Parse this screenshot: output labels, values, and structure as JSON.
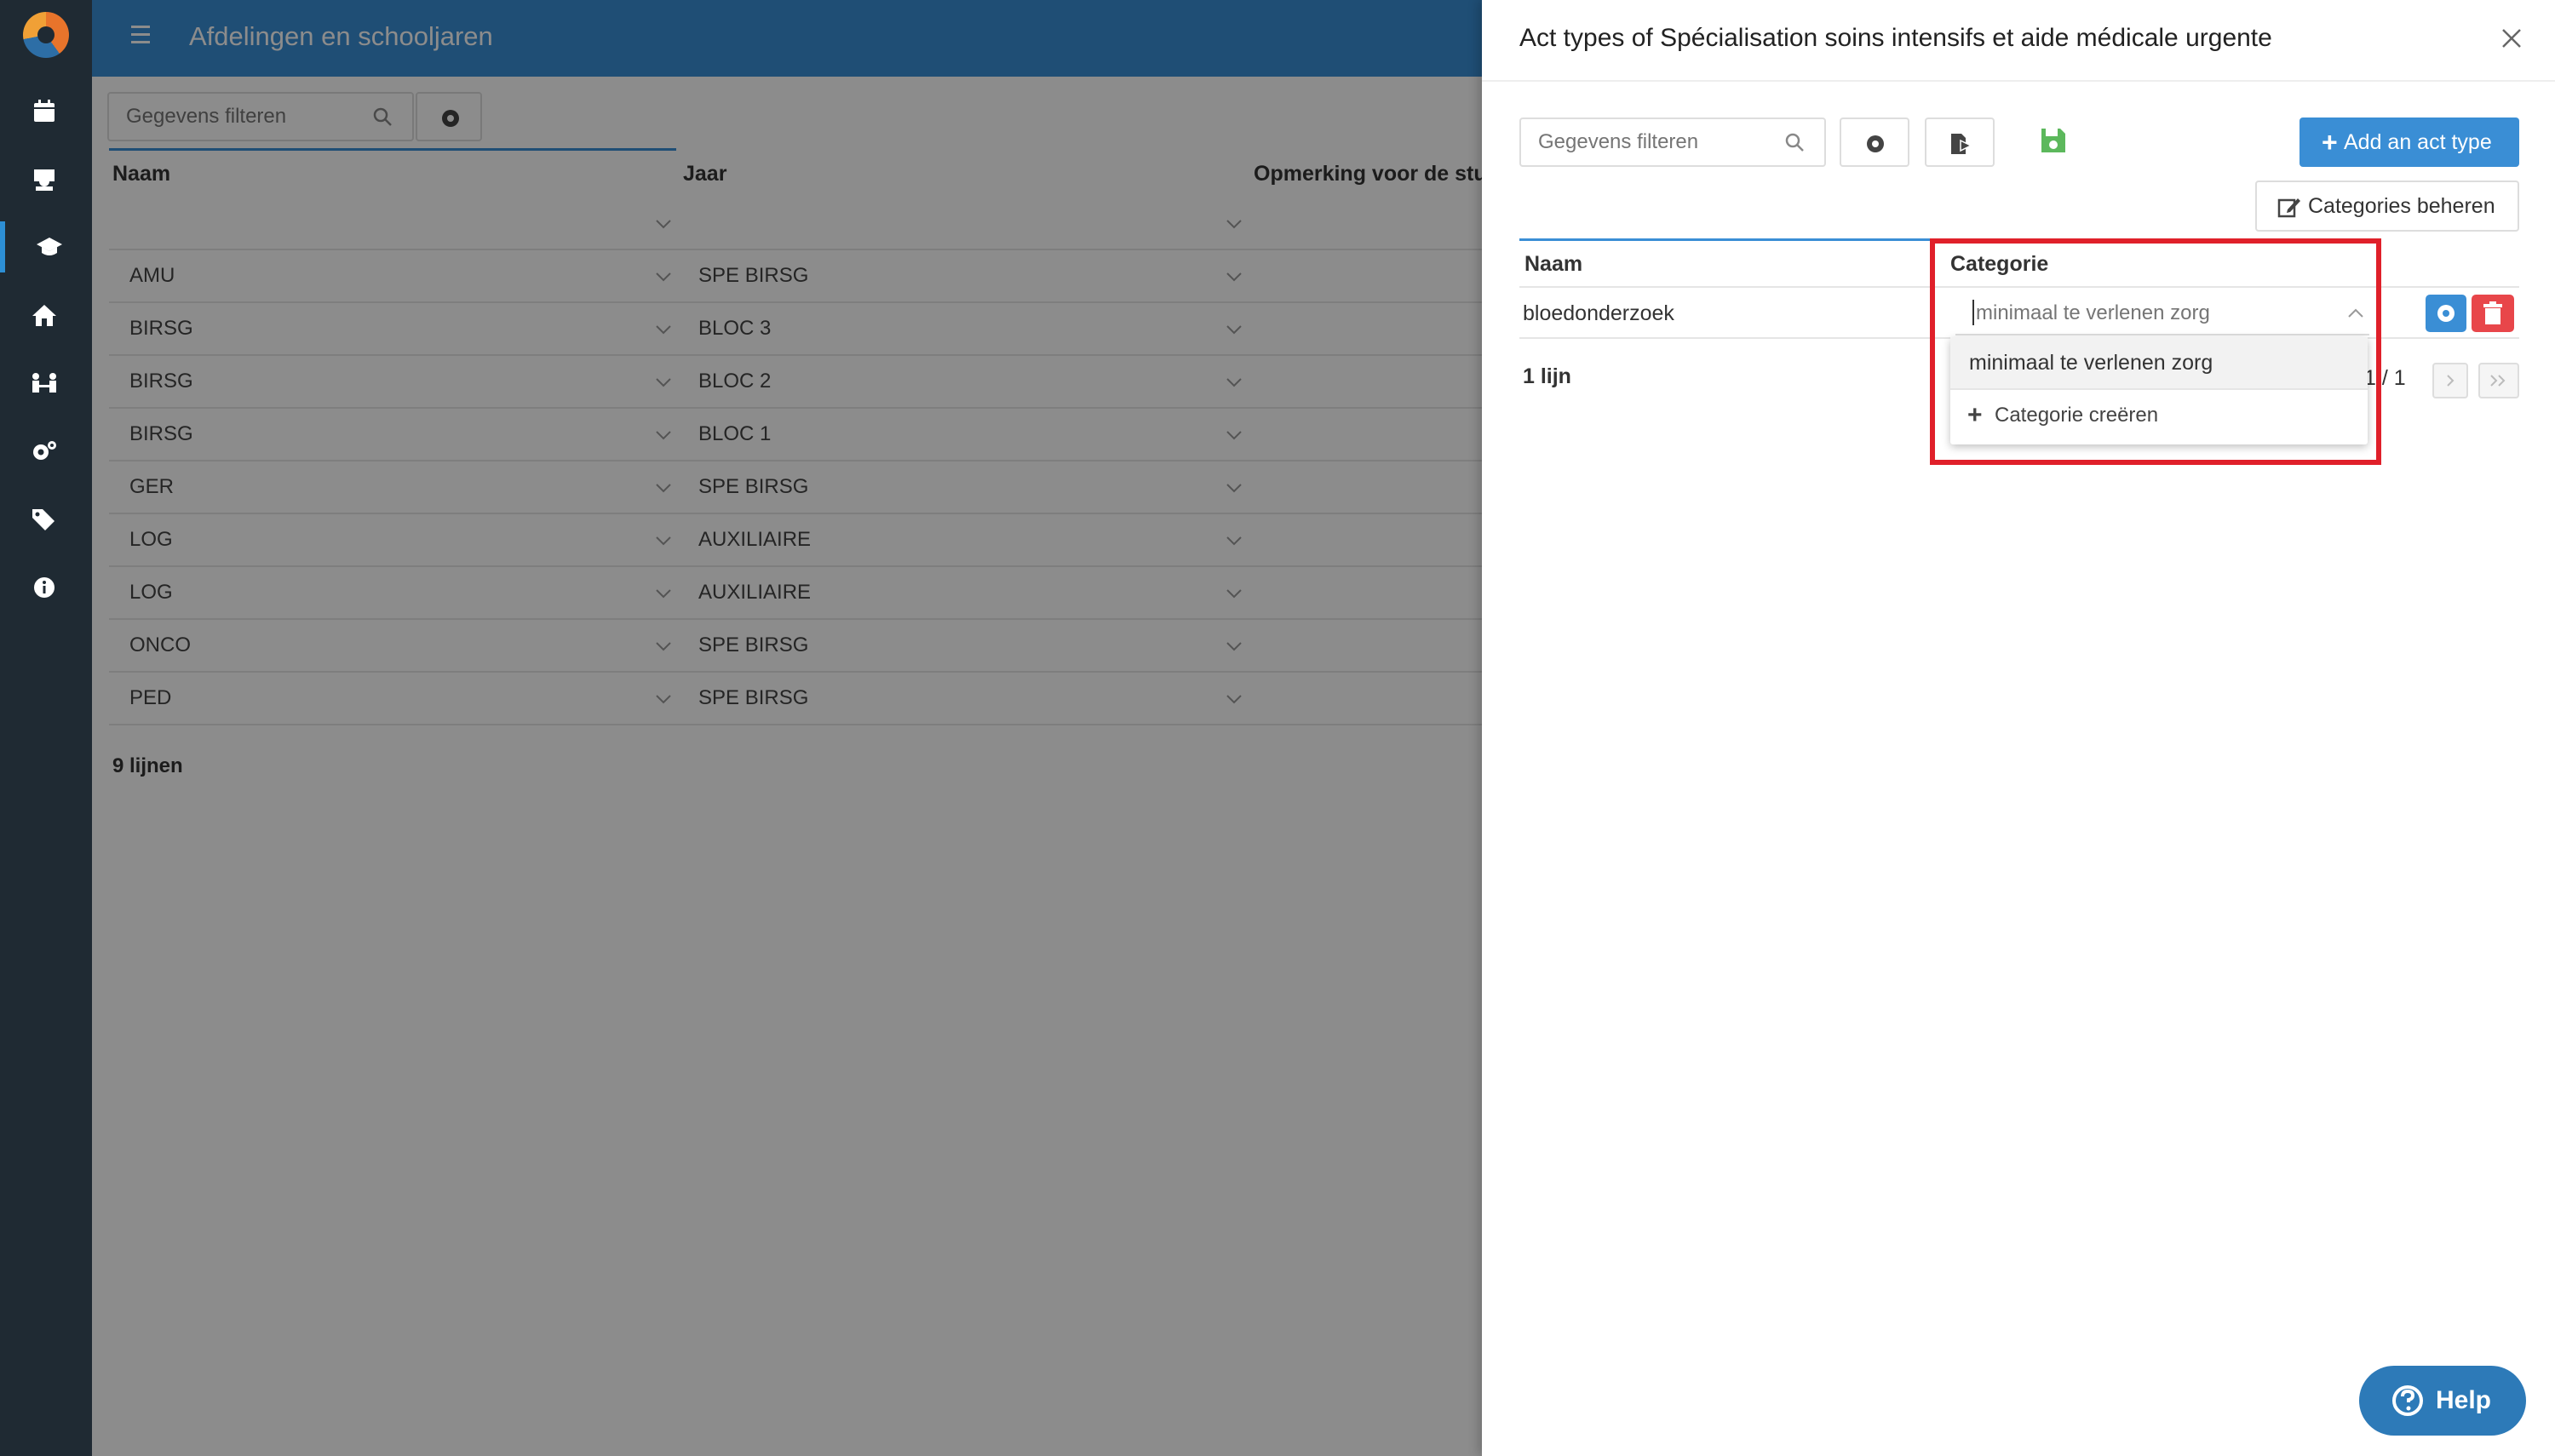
{
  "sidebar": {
    "items": [
      {
        "name": "calendar-icon"
      },
      {
        "name": "student-icon"
      },
      {
        "name": "graduation-cap-icon"
      },
      {
        "name": "home-icon"
      },
      {
        "name": "people-connect-icon"
      },
      {
        "name": "gears-icon"
      },
      {
        "name": "tags-icon"
      },
      {
        "name": "info-icon"
      }
    ]
  },
  "header": {
    "title": "Afdelingen en schooljaren"
  },
  "main": {
    "filter_placeholder": "Gegevens filteren",
    "columns": [
      "Naam",
      "Jaar",
      "Opmerking voor de stud"
    ],
    "rows": [
      {
        "naam": "AMU",
        "jaar": "SPE BIRSG"
      },
      {
        "naam": "BIRSG",
        "jaar": "BLOC 3"
      },
      {
        "naam": "BIRSG",
        "jaar": "BLOC 2"
      },
      {
        "naam": "BIRSG",
        "jaar": "BLOC 1"
      },
      {
        "naam": "GER",
        "jaar": "SPE BIRSG"
      },
      {
        "naam": "LOG",
        "jaar": "AUXILIAIRE"
      },
      {
        "naam": "LOG",
        "jaar": "AUXILIAIRE"
      },
      {
        "naam": "ONCO",
        "jaar": "SPE BIRSG"
      },
      {
        "naam": "PED",
        "jaar": "SPE BIRSG"
      }
    ],
    "lines_count": "9 lijnen"
  },
  "drawer": {
    "title": "Act types of Spécialisation soins intensifs et aide médicale urgente",
    "filter_placeholder": "Gegevens filteren",
    "add_label": "Add an act type",
    "categories_label": "Categories beheren",
    "columns": [
      "Naam",
      "Categorie"
    ],
    "row": {
      "naam": "bloedonderzoek",
      "categorie_placeholder": "minimaal te verlenen zorg"
    },
    "dropdown": {
      "options": [
        "minimaal te verlenen zorg"
      ],
      "create_label": "Categorie creëren"
    },
    "lines_count": "1 lijn",
    "pages": "1 / 1"
  },
  "help": {
    "label": "Help"
  },
  "colors": {
    "accent": "#3a8ed5",
    "danger": "#e8464a",
    "save": "#5cb85c",
    "highlight": "#e0202a"
  }
}
